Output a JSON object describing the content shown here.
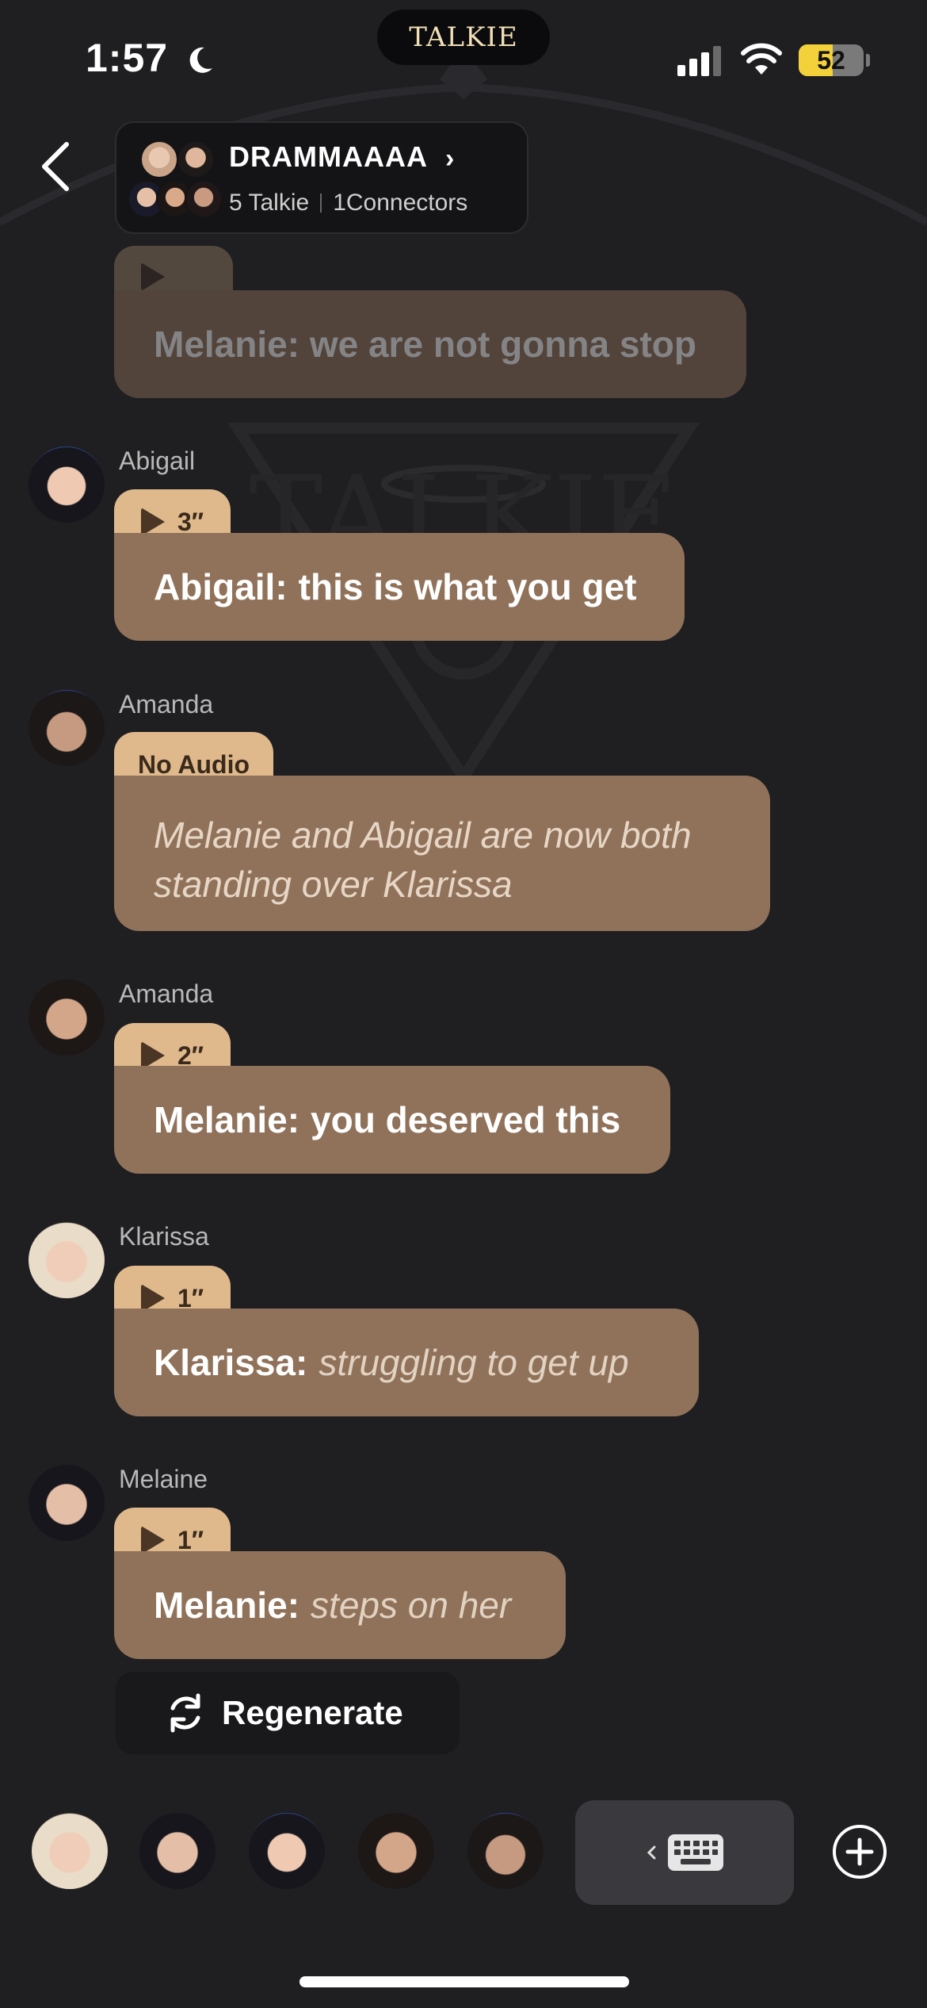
{
  "status_bar": {
    "time": "1:57",
    "logo": "TALKIE",
    "battery": "52",
    "battery_level": 0.52,
    "icons": [
      "moon-icon",
      "signal-icon",
      "wifi-icon",
      "battery-icon"
    ]
  },
  "header": {
    "group_name": "DRAMMAAAA",
    "chevron": "›",
    "talkie_count": "5 Talkie",
    "connectors": "1Connectors"
  },
  "messages": [
    {
      "sender": "",
      "tag": "",
      "text": "Melanie: we are not gonna stop",
      "faded": true
    },
    {
      "sender": "Abigail",
      "tag": "3″",
      "speaker": "Abigail:",
      "text": "this is what you get"
    },
    {
      "sender": "Amanda",
      "tag": "No Audio",
      "narration": "Melanie and Abigail are now both standing over Klarissa"
    },
    {
      "sender": "Amanda",
      "tag": "2″",
      "speaker": "Melanie:",
      "text": "you deserved this"
    },
    {
      "sender": "Klarissa",
      "tag": "1″",
      "speaker": "Klarissa:",
      "action": "struggling to get up"
    },
    {
      "sender": "Melaine",
      "tag": "1″",
      "speaker": "Melanie:",
      "action": "steps on her"
    }
  ],
  "regenerate_label": "Regenerate",
  "colors": {
    "background": "#1f1f22",
    "bubble": "#90725a",
    "tag": "#dfb98c",
    "battery": "#f3d13a"
  }
}
